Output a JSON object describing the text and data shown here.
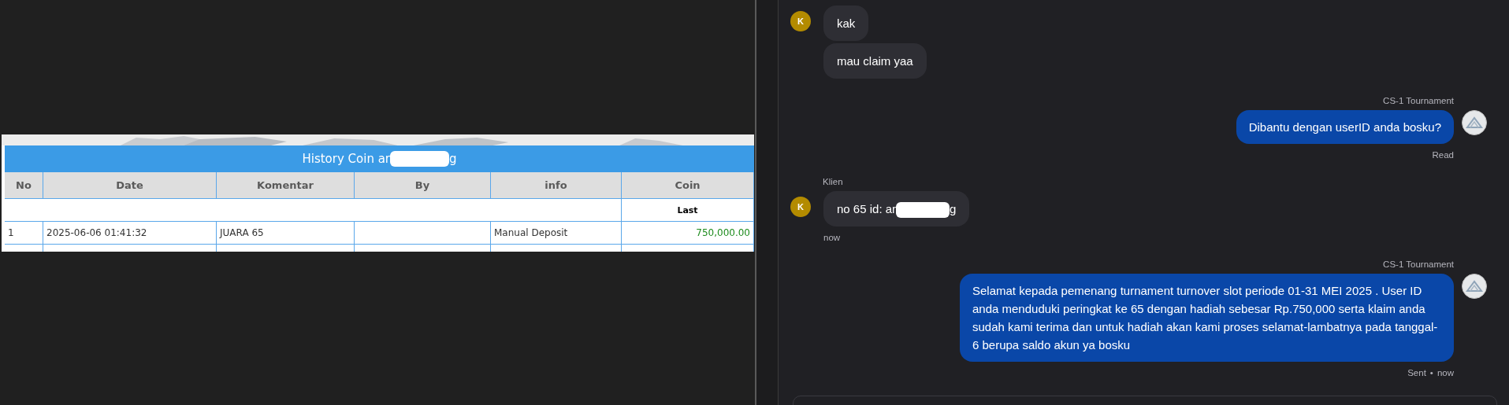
{
  "history_table": {
    "title_prefix": "History Coin ar",
    "title_suffix": "g",
    "columns": [
      "No",
      "Date",
      "Komentar",
      "By",
      "info",
      "Coin"
    ],
    "subheader": "Last",
    "rows": [
      {
        "no": "1",
        "date": "2025-06-06 01:41:32",
        "komentar": "JUARA 65",
        "info": "Manual Deposit",
        "coin": "750,000.00"
      }
    ]
  },
  "chat": {
    "messages": [
      {
        "kind": "incoming",
        "avatar": "K",
        "text": "kak"
      },
      {
        "kind": "incoming",
        "text": "mau claim yaa"
      },
      {
        "kind": "outgoing",
        "sender": "CS-1 Tournament",
        "text": "Dibantu dengan userID anda bosku?",
        "status": "Read"
      },
      {
        "kind": "incoming",
        "sender": "Klien",
        "avatar": "K",
        "redacted": true,
        "text_before": "no 65 id: ar",
        "text_after": "g",
        "time": "now"
      },
      {
        "kind": "outgoing",
        "sender": "CS-1 Tournament",
        "text": "Selamat kepada pemenang turnament turnover slot periode 01-31 MEI 2025 . User ID anda menduduki peringkat ke 65 dengan hadiah sebesar Rp.750,000 serta klaim anda sudah kami terima dan untuk hadiah akan kami proses selamat-lambatnya pada tanggal- 6 berupa saldo akun ya bosku",
        "status": "Sent",
        "separator": "•",
        "time": "now"
      }
    ]
  }
}
